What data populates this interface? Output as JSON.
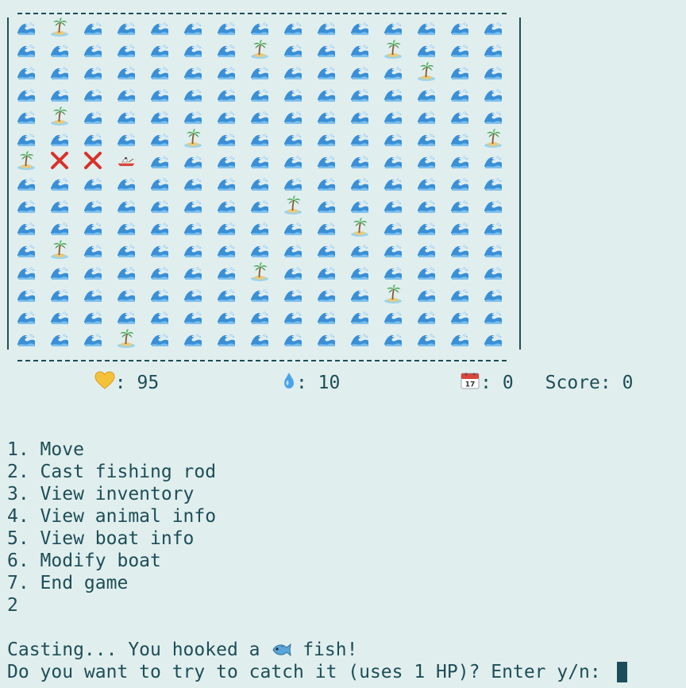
{
  "map": {
    "rows": [
      "WIWWWWWWWWWWWWW",
      "WWWWWWWIWWWIWWW",
      "WWWWWWWWWWWWIWW",
      "WWWWWWWWWWWWWWW",
      "WIWWWWWWWWWWWWW",
      "WWWWWIWWWWWWWWI",
      "IXXBWWWWWWWWWWW",
      "WWWWWWWWWWWWWWW",
      "WWWWWWWWIWWWWWW",
      "WWWWWWWWWWIWWWW",
      "WIWWWWWWWWWWWWW",
      "WWWWWWWIWWWWWWW",
      "WWWWWWWWWWWIWWW",
      "WWWWWWWWWWWWWWW",
      "WWWIWWWWWWWWWWW"
    ],
    "legend_icons": {
      "W": "water-wave-icon",
      "I": "island-icon",
      "X": "visited-x-icon",
      "B": "boat-icon"
    }
  },
  "stats": {
    "health_icon": "yellow-heart-icon",
    "health_label": ": 95",
    "water_icon": "water-drop-icon",
    "water_label": ": 10",
    "day_icon": "calendar-icon",
    "day_label": ": 0",
    "score_label": "Score: 0"
  },
  "menu": {
    "items": [
      "1. Move",
      "2. Cast fishing rod",
      "3. View inventory",
      "4. View animal info",
      "5. View boat info",
      "6. Modify boat",
      "7. End game"
    ],
    "user_choice": "2"
  },
  "messages": {
    "cast_prefix": "Casting... You hooked a ",
    "fish_icon": "fish-icon",
    "cast_suffix": " fish!",
    "prompt": "Do you want to try to catch it (uses 1 HP)? Enter y/n: "
  },
  "colors": {
    "background": "#e1eeee",
    "text": "#1d4e57",
    "wave": "#3a8fd6",
    "x_mark": "#d9302a"
  }
}
